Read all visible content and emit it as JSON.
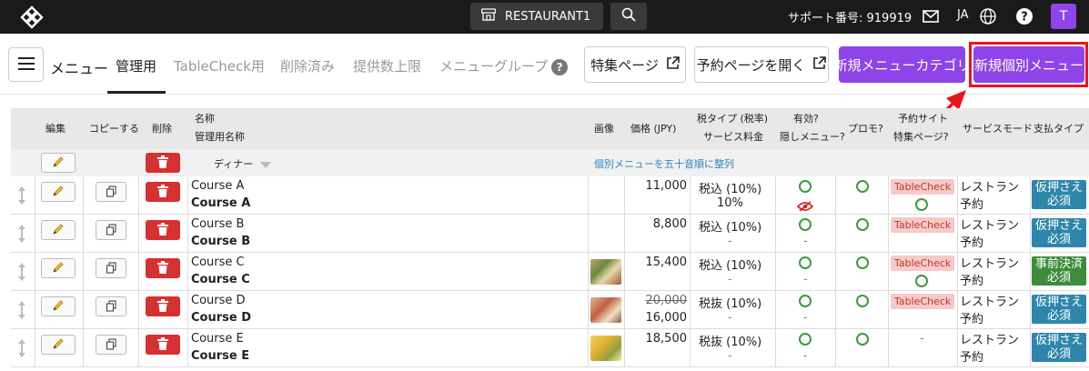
{
  "topbar": {
    "restaurant": "RESTAURANT1",
    "support": "サポート番号: 919919",
    "lang": "JA",
    "avatar": "T"
  },
  "nav": {
    "title": "メニュー",
    "tabs": [
      "管理用",
      "TableCheck用",
      "削除済み",
      "提供数上限",
      "メニューグループ"
    ],
    "buttons": {
      "feature_page": "特集ページ",
      "open_booking": "予約ページを開く",
      "new_category": "新規メニューカテゴリ",
      "new_item": "新規個別メニュー"
    }
  },
  "table": {
    "headers": {
      "edit": "編集",
      "copy": "コピーする",
      "delete": "削除",
      "name": "名称",
      "admin_name": "管理用名称",
      "image": "画像",
      "price": "価格 (JPY)",
      "tax": "税タイプ (税率)",
      "service": "サービス料金",
      "active": "有効?",
      "hidden": "隠しメニュー?",
      "promo": "プロモ?",
      "booking_site": "予約サイト",
      "feature": "特集ページ?",
      "service_mode": "サービスモード",
      "payment": "支払タイプ"
    },
    "group": {
      "name": "ディナー",
      "sort_link": "個別メニューを五十音順に整列"
    },
    "rows": [
      {
        "name": "Course A",
        "admin": "Course A",
        "price": "11,000",
        "price_old": "",
        "tax": "税込 (10%)",
        "service": "10%",
        "hidden": true,
        "tablecheck": true,
        "feature_circle": true,
        "mode": "レストラン予約",
        "pay": "仮押さえ必須",
        "pay_color": "blue",
        "image": ""
      },
      {
        "name": "Course B",
        "admin": "Course B",
        "price": "8,800",
        "price_old": "",
        "tax": "税込 (10%)",
        "service": "-",
        "hidden": false,
        "tablecheck": true,
        "feature_circle": false,
        "mode": "レストラン予約",
        "pay": "仮押さえ必須",
        "pay_color": "blue",
        "image": ""
      },
      {
        "name": "Course C",
        "admin": "Course C",
        "price": "15,400",
        "price_old": "",
        "tax": "税込 (10%)",
        "service": "-",
        "hidden": false,
        "tablecheck": true,
        "feature_circle": true,
        "mode": "レストラン予約",
        "pay": "事前決済必須",
        "pay_color": "green",
        "image": "food1"
      },
      {
        "name": "Course D",
        "admin": "Course D",
        "price": "16,000",
        "price_old": "20,000",
        "tax": "税抜 (10%)",
        "service": "-",
        "hidden": false,
        "tablecheck": true,
        "feature_circle": false,
        "mode": "レストラン予約",
        "pay": "仮押さえ必須",
        "pay_color": "blue",
        "image": "food2"
      },
      {
        "name": "Course E",
        "admin": "Course E",
        "price": "18,500",
        "price_old": "",
        "tax": "税抜 (10%)",
        "service": "-",
        "hidden": false,
        "tablecheck": false,
        "feature_circle": false,
        "mode": "レストラン予約",
        "pay": "仮押さえ必須",
        "pay_color": "blue",
        "image": "food3"
      }
    ],
    "dash": "-"
  },
  "colors": {
    "primary": "#8e44e8",
    "danger": "#d63131",
    "highlight": "#e8161e",
    "pay_blue": "#2e86ab",
    "pay_green": "#3c8c3c"
  }
}
